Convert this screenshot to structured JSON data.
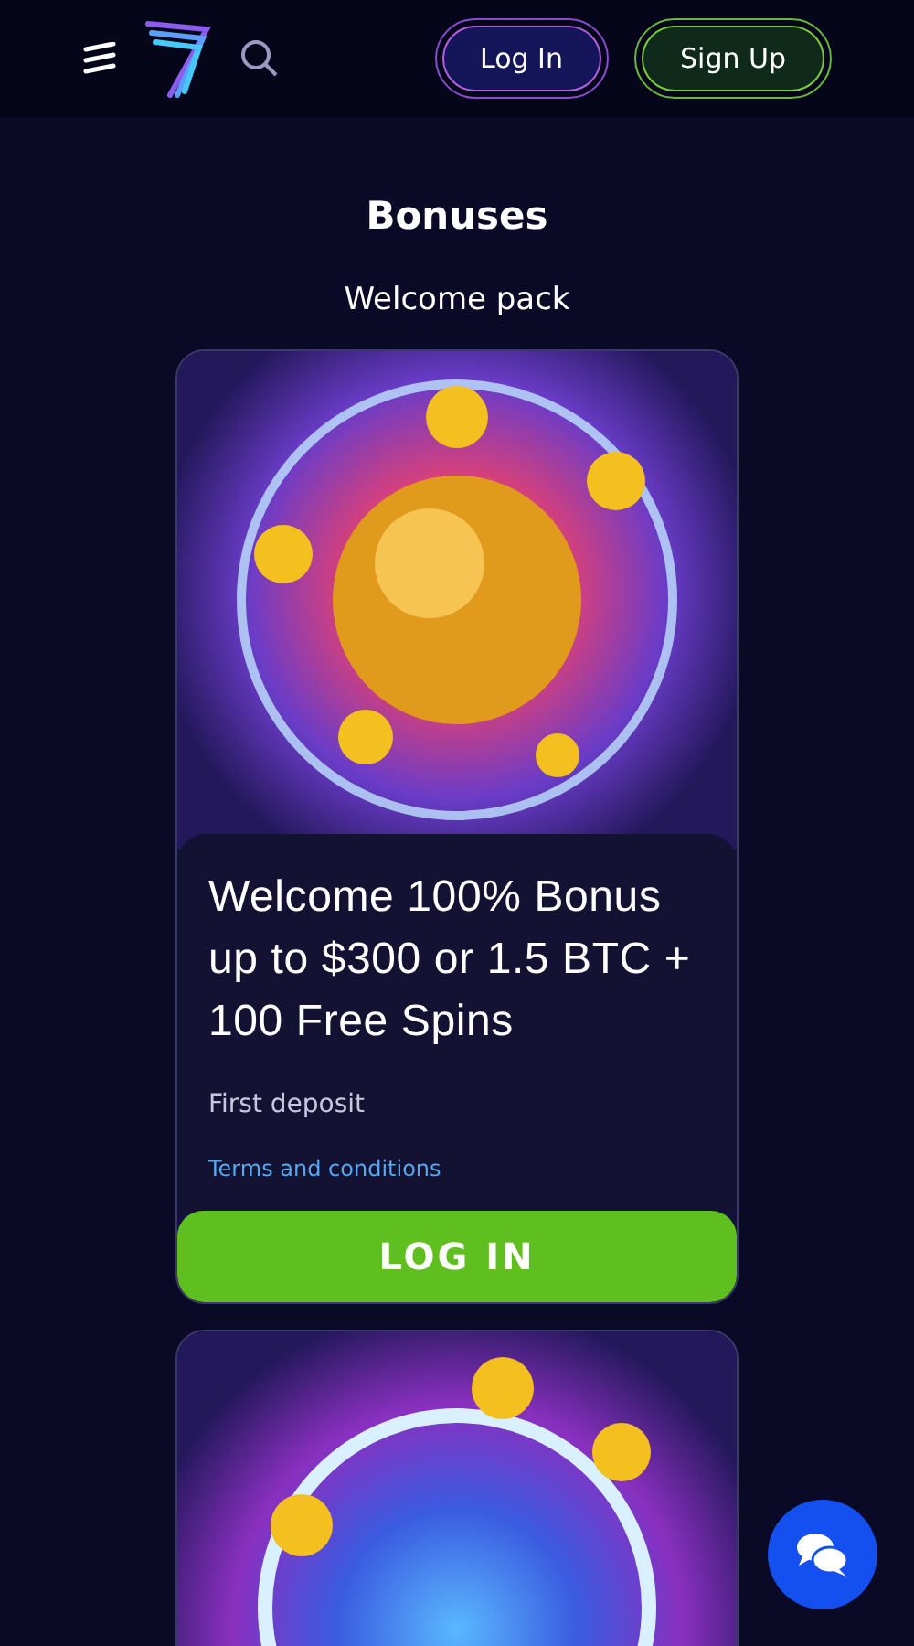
{
  "header": {
    "login_label": "Log In",
    "signup_label": "Sign Up"
  },
  "page_title": "Bonuses",
  "section_title": "Welcome pack",
  "bonuses": [
    {
      "kind": "disco",
      "title": "Welcome 100% Bonus up to $300 or 1.5 BTC + 100 Free Spins",
      "subtitle": "First deposit",
      "terms_link": "Terms and conditions",
      "button_label": "LOG IN"
    },
    {
      "kind": "diamond"
    }
  ]
}
